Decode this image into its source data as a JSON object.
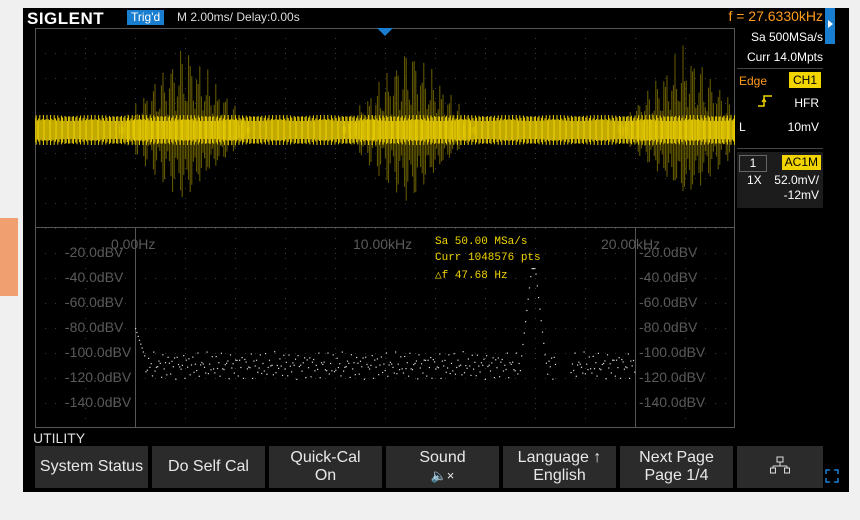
{
  "header": {
    "logo": "SIGLENT",
    "trigger_status": "Trig'd",
    "timebase": "M 2.00ms/ Delay:0.00s",
    "frequency": "f = 27.6330kHz"
  },
  "acquisition": {
    "sample_rate": "Sa 500MSa/s",
    "memory": "Curr 14.0Mpts"
  },
  "trigger": {
    "type_label": "Edge",
    "source": "CH1",
    "coupling": "HFR",
    "level_label": "L",
    "level": "10mV"
  },
  "channel": {
    "number": "1",
    "coupling": "AC1M",
    "probe": "1X",
    "scale": "52.0mV/",
    "offset": "-12mV",
    "marker": "1"
  },
  "fft": {
    "sample_rate": "Sa 50.00 MSa/s",
    "points": "Curr 1048576 pts",
    "delta_f": "△f 47.68 Hz",
    "freq_labels": [
      "0.00Hz",
      "10.00kHz",
      "20.00kHz"
    ],
    "db_labels_left": [
      "-20.0dBV",
      "-40.0dBV",
      "-60.0dBV",
      "-80.0dBV",
      "-100.0dBV",
      "-120.0dBV",
      "-140.0dBV"
    ],
    "db_labels_right": [
      "-20.0dBV",
      "-40.0dBV",
      "-60.0dBV",
      "-80.0dBV",
      "-100.0dBV",
      "-120.0dBV",
      "-140.0dBV"
    ]
  },
  "menu": {
    "title": "UTILITY",
    "softkeys": [
      {
        "line1": "System Status",
        "line2": ""
      },
      {
        "line1": "Do Self Cal",
        "line2": ""
      },
      {
        "line1": "Quick-Cal",
        "line2": "On"
      },
      {
        "line1": "Sound",
        "line2": "🔈×"
      },
      {
        "line1": "Language ↑",
        "line2": "English"
      },
      {
        "line1": "Next Page",
        "line2": "Page 1/4"
      }
    ]
  },
  "colors": {
    "trace": "#f2d400",
    "trace_dim": "#6b6000",
    "accent_blue": "#1a7ed0",
    "freq_orange": "#ff9c1a"
  },
  "icons": [
    "menu-tab-icon",
    "trigger-position-icon",
    "rising-edge-icon",
    "network-icon",
    "expand-icon",
    "speaker-muted-icon"
  ]
}
